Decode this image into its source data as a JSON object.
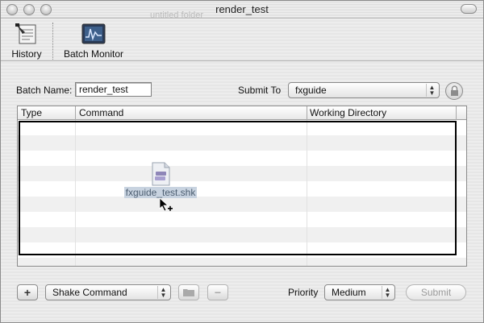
{
  "window": {
    "title": "render_test",
    "ghost_title": "untitled folder"
  },
  "toolbar": {
    "history_label": "History",
    "history_icon": "history-document-icon",
    "batch_monitor_label": "Batch Monitor",
    "batch_monitor_icon": "waveform-monitor-icon"
  },
  "form": {
    "batch_name_label": "Batch Name:",
    "batch_name_value": "render_test",
    "submit_to_label": "Submit To",
    "submit_to_value": "fxguide"
  },
  "table": {
    "columns": [
      "Type",
      "Command",
      "Working Directory"
    ],
    "rows": []
  },
  "drag": {
    "file_name": "fxguide_test.shk"
  },
  "bottom": {
    "add_label": "+",
    "command_type_value": "Shake Command",
    "remove_label": "−",
    "priority_label": "Priority",
    "priority_value": "Medium",
    "submit_label": "Submit"
  },
  "colors": {
    "selection_bg": "#c8d3e0",
    "drop_outline": "#000000"
  }
}
